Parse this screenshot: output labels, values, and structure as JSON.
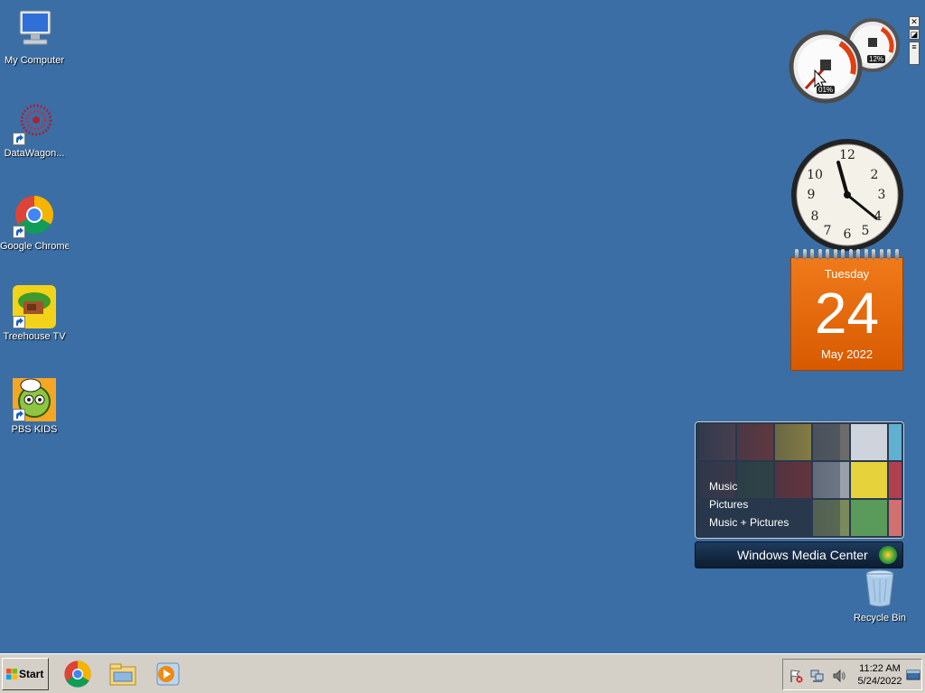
{
  "desktop": {
    "icons": [
      {
        "label": "My Computer"
      },
      {
        "label": "DataWagon..."
      },
      {
        "label": "Google Chrome"
      },
      {
        "label": "Treehouse TV"
      },
      {
        "label": "PBS KIDS"
      },
      {
        "label": "Recycle Bin"
      }
    ]
  },
  "gadgets": {
    "cpu_meter": {
      "cpu": "01%",
      "memory": "12%"
    },
    "clock": {
      "time": "11:22"
    },
    "calendar": {
      "day_of_week": "Tuesday",
      "day": "24",
      "month_year": "May 2022"
    },
    "media_center": {
      "menu": [
        "Music",
        "Pictures",
        "Music + Pictures"
      ],
      "title": "Windows Media Center"
    }
  },
  "taskbar": {
    "start_label": "Start",
    "pinned": [
      "chrome-icon",
      "windows-explorer-icon",
      "media-player-icon"
    ],
    "tray": {
      "time": "11:22 AM",
      "date": "5/24/2022"
    }
  }
}
